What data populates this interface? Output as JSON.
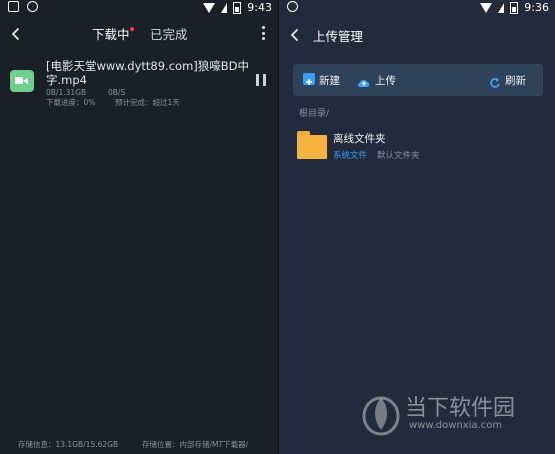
{
  "left_screen": {
    "status_time": "9:43",
    "tabs": [
      {
        "label": "下载中",
        "active": true,
        "has_dot": true
      },
      {
        "label": "已完成",
        "active": false
      }
    ],
    "download": {
      "title_line1": "[电影天堂www.dytt89.com]狼嚎BD中",
      "title_line2": "字.mp4",
      "size": "0B/1.31GB",
      "speed": "0B/S",
      "progress": "下载进度：0%",
      "eta": "预计完成：超过1天"
    },
    "footer": {
      "storage_info": "存储信息：13.1GB/15.62GB",
      "storage_location": "存储位置：内部存储/MT下载器/"
    }
  },
  "right_screen": {
    "status_time": "9:36",
    "title": "上传管理",
    "toolbar": {
      "new_label": "新建",
      "upload_label": "上传",
      "refresh_label": "刷新"
    },
    "root_label": "根目录/",
    "folder": {
      "name": "离线文件夹",
      "tag": "系统文件",
      "desc": "默认文件夹"
    }
  },
  "watermark": {
    "brand": "当下软件园",
    "url": "www.downxia.com"
  },
  "colors": {
    "accent_red": "#ff3b3b",
    "accent_blue": "#3aa0ff",
    "folder_yellow": "#f7b340",
    "video_green": "#6fcf8c"
  }
}
